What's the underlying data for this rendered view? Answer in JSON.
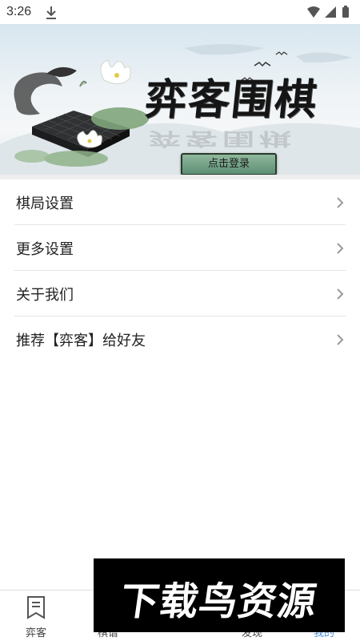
{
  "status_bar": {
    "time": "3:26",
    "icons": [
      "download-icon",
      "wifi-icon",
      "cell-signal-icon",
      "battery-icon"
    ]
  },
  "banner": {
    "title": "弈客围棋",
    "login_label": "点击登录"
  },
  "menu": {
    "items": [
      {
        "label": "棋局设置"
      },
      {
        "label": "更多设置"
      },
      {
        "label": "关于我们"
      },
      {
        "label": "推荐【弈客】给好友"
      }
    ]
  },
  "bottom_nav": {
    "items": [
      {
        "label": "弈客",
        "icon": "bookmark-icon",
        "active": false
      },
      {
        "label": "棋谱",
        "icon": "board-icon",
        "active": false
      },
      {
        "label": "",
        "icon": "",
        "active": false
      },
      {
        "label": "发现",
        "icon": "discover-icon",
        "active": false
      },
      {
        "label": "我的",
        "icon": "user-icon",
        "active": true
      }
    ]
  },
  "watermark": {
    "text": "下载鸟资源"
  },
  "colors": {
    "accent": "#4d8fd8",
    "login_button": "#6f9f84",
    "divider": "#e3e3e3"
  }
}
